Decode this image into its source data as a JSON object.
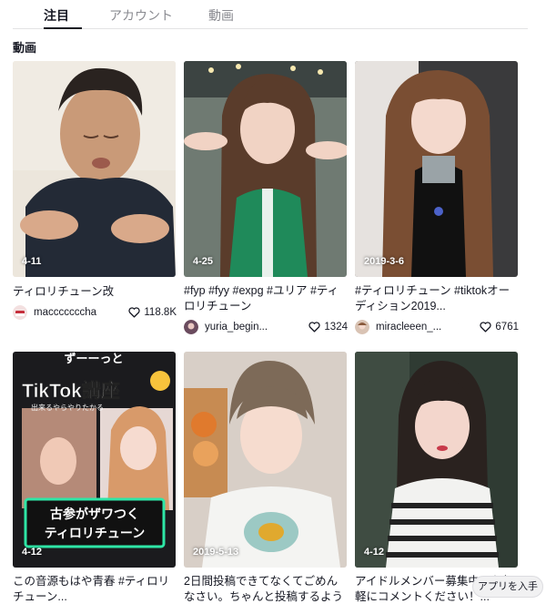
{
  "tabs": [
    {
      "label": "注目"
    },
    {
      "label": "アカウント"
    },
    {
      "label": "動画"
    }
  ],
  "section_title": "動画",
  "videos": [
    {
      "date": "4-11",
      "desc": "ティロリチューン改",
      "author": "macccccccha",
      "likes": "118.8K"
    },
    {
      "date": "4-25",
      "desc": "#fyp #fyy #expg #ユリア #ティロリチューン",
      "author": "yuria_begin...",
      "likes": "1324"
    },
    {
      "date": "2019-3-6",
      "desc": "#ティロリチューン #tiktokオーディション2019...",
      "author": "miracleeen_...",
      "likes": "6761"
    },
    {
      "date": "4-12",
      "desc": "この音源もはや青春 #ティロリチューン...",
      "author": "",
      "likes": "",
      "thumb_text": {
        "top": "ずーーっと",
        "title": "TikTok講座",
        "sub": "出来るやらやりたかる",
        "caption": "古参がザワつく\nティロリチューン"
      }
    },
    {
      "date": "2019-5-13",
      "desc": "2日間投稿できてなくてごめんなさい。ちゃんと投稿するように...",
      "author": "",
      "likes": ""
    },
    {
      "date": "4-12",
      "desc": "アイドルメンバー募集中！お気軽にコメントください！...",
      "author": "",
      "likes": ""
    }
  ],
  "app_badge": "アプリを入手",
  "colors": {
    "text": "#161823",
    "muted": "#8a8b91",
    "divider": "#e3e3e4",
    "heart": "#161823"
  }
}
